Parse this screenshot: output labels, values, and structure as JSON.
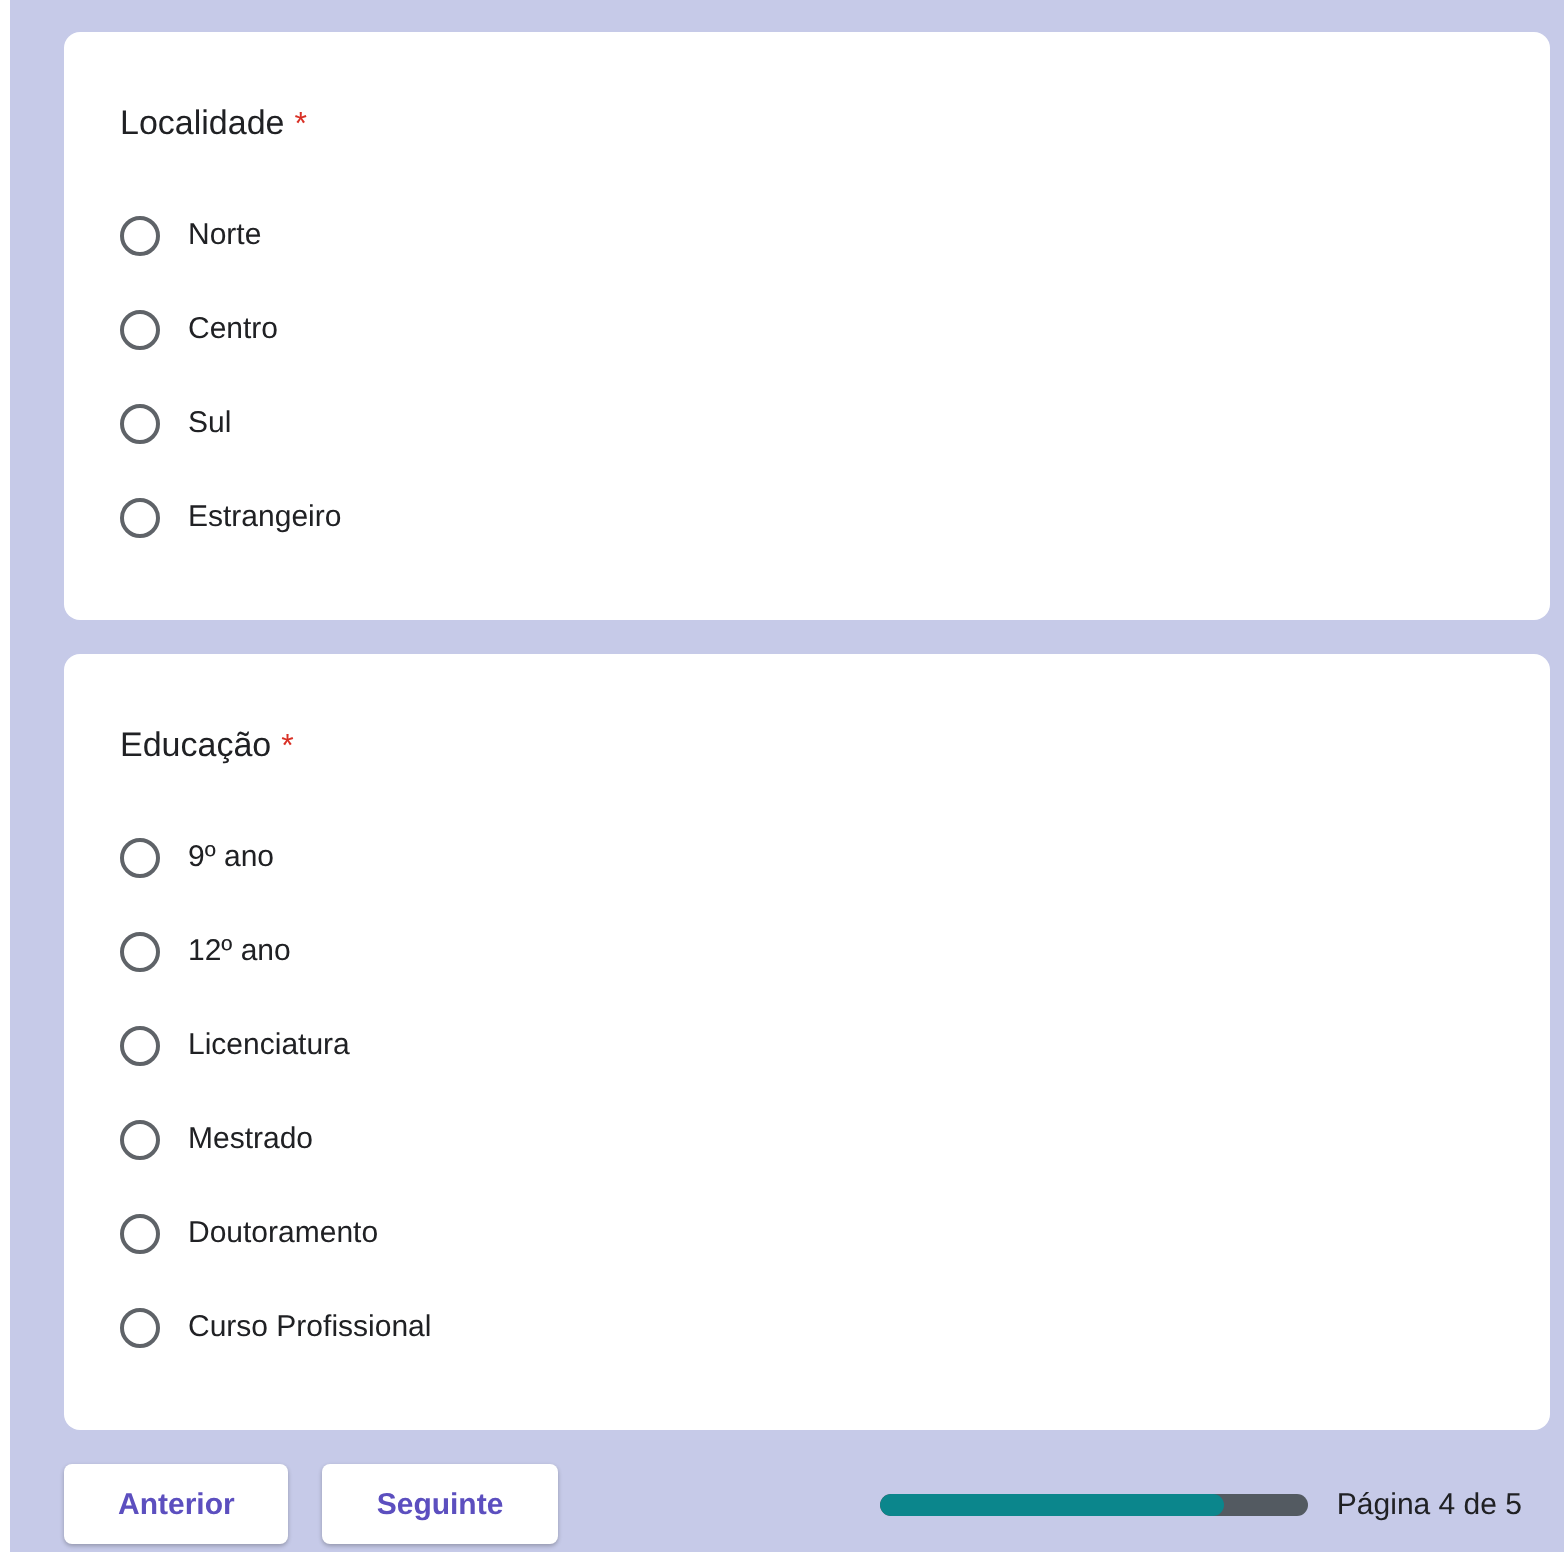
{
  "questions": [
    {
      "title": "Localidade",
      "required_mark": "*",
      "options": [
        {
          "label": "Norte",
          "selected": false
        },
        {
          "label": "Centro",
          "selected": false
        },
        {
          "label": "Sul",
          "selected": false
        },
        {
          "label": "Estrangeiro",
          "selected": false
        }
      ]
    },
    {
      "title": "Educação",
      "required_mark": "*",
      "options": [
        {
          "label": "9º ano",
          "selected": false
        },
        {
          "label": "12º ano",
          "selected": false
        },
        {
          "label": "Licenciatura",
          "selected": false
        },
        {
          "label": "Mestrado",
          "selected": false
        },
        {
          "label": "Doutoramento",
          "selected": false
        },
        {
          "label": "Curso Profissional",
          "selected": false
        }
      ]
    }
  ],
  "buttons": [
    "Anterior",
    "Seguinte"
  ],
  "progress": {
    "level": 0.8,
    "label": "Página 4 de 5"
  }
}
